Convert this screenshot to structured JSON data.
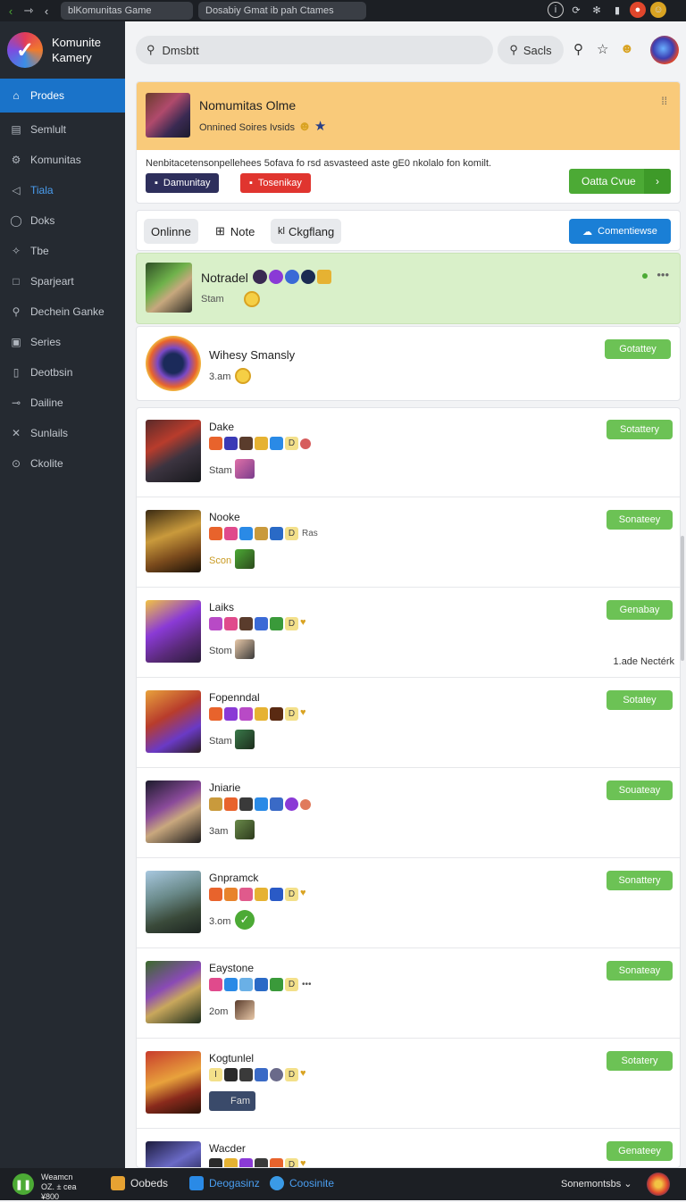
{
  "topbar": {
    "tabs": [
      "blKomunitas Game",
      "Dosabiy Gmat ib pah Ctames"
    ]
  },
  "sidebar": {
    "brand": "Komunite Kamery",
    "items": [
      {
        "label": "Prodes",
        "icon": "home-icon"
      },
      {
        "label": "Semlult",
        "icon": "calendar-icon"
      },
      {
        "label": "Komunitas",
        "icon": "gear-icon"
      },
      {
        "label": "Tiala",
        "icon": "flag-icon"
      },
      {
        "label": "Doks",
        "icon": "chat-icon"
      },
      {
        "label": "Tbe",
        "icon": "star-icon"
      },
      {
        "label": "Sparjeart",
        "icon": "square-icon"
      },
      {
        "label": "Dechein Ganke",
        "icon": "search-icon"
      },
      {
        "label": "Series",
        "icon": "series-icon"
      },
      {
        "label": "Deotbsin",
        "icon": "doc-icon"
      },
      {
        "label": "Dailine",
        "icon": "link-icon"
      },
      {
        "label": "Sunlails",
        "icon": "cross-icon"
      },
      {
        "label": "Ckolite",
        "icon": "circle-icon"
      }
    ]
  },
  "header": {
    "search_value": "Dmsbtt",
    "search_button": "Sacls"
  },
  "community": {
    "title": "Nomumitas Olme",
    "subtitle": "Onnined Soires Ivsids",
    "description": "Nenbitacetensonpellehees 5ofava fo rsd asvasteed aste gE0 nkolalo fon komilt.",
    "pill1": "Damunitay",
    "pill2": "Tosenikay",
    "join_label": "Oatta Cvue"
  },
  "filters": {
    "chip_online": "Onlinne",
    "chip_note": "Note",
    "chip_cat": "Ckgflang",
    "add_button": "Comentiewse"
  },
  "featured": {
    "name": "Notradel",
    "sub": "Stam"
  },
  "second": {
    "name": "Wihesy Smansly",
    "sub": "3.am",
    "button": "Gotattey"
  },
  "rows": [
    {
      "name": "Dake",
      "time": "Stam",
      "button": "Sotattery",
      "extra": ""
    },
    {
      "name": "Nooke",
      "time": "Scon",
      "button": "Sonateey",
      "extra": "Ras"
    },
    {
      "name": "Laiks",
      "time": "Stom",
      "button": "Genabay",
      "extra": "",
      "note": "1.ade Nectérk"
    },
    {
      "name": "Fopenndal",
      "time": "Stam",
      "button": "Sotatey",
      "extra": ""
    },
    {
      "name": "Jniarie",
      "time": "3am",
      "button": "Souateay",
      "extra": ""
    },
    {
      "name": "Gnpramck",
      "time": "3.om",
      "button": "Sonattery",
      "extra": ""
    },
    {
      "name": "Eaystone",
      "time": "2om",
      "button": "Sonateay",
      "extra": "•••"
    },
    {
      "name": "Kogtunlel",
      "time": "Fam",
      "button": "Sotatery",
      "extra": ""
    },
    {
      "name": "Wacder",
      "time": "",
      "button": "Genateey",
      "extra": ""
    }
  ],
  "bottombar": {
    "player_line1": "Weamcn",
    "player_line2": "OZ. ± cea",
    "player_line3": "¥800",
    "items": [
      "Oobeds",
      "Deogasinz",
      "Coosinite"
    ],
    "right_label": "Sonemontsbs"
  }
}
